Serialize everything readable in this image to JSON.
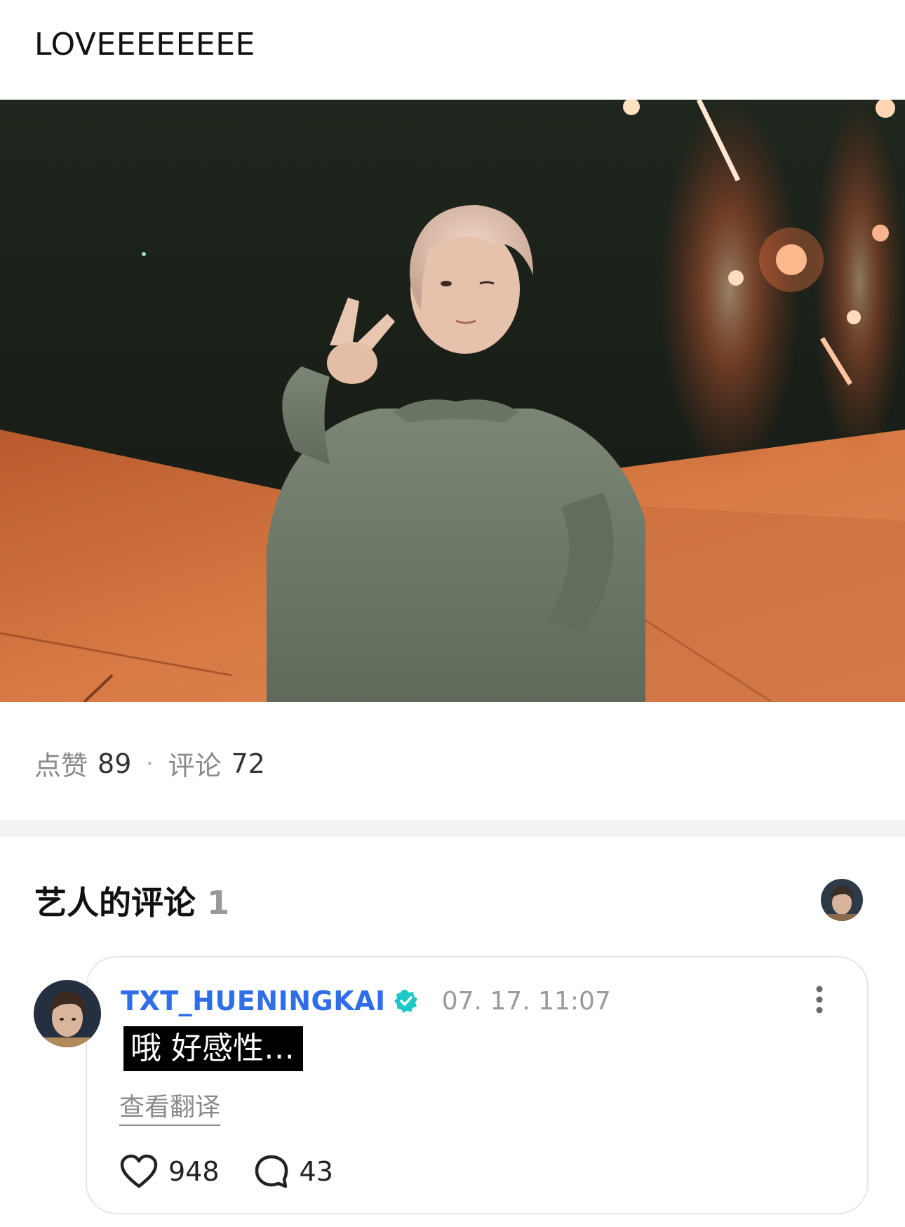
{
  "post": {
    "text": "LOVEEEEEEEE"
  },
  "stats": {
    "likes_label": "点赞",
    "likes_count": "89",
    "separator": "·",
    "comments_label": "评论",
    "comments_count": "72"
  },
  "artist_comments": {
    "title": "艺人的评论",
    "count": "1"
  },
  "comment": {
    "username": "TXT_HUENINGKAI",
    "timestamp": "07. 17. 11:07",
    "text": "哦 好感性…",
    "translate_label": "查看翻译",
    "likes": "948",
    "replies": "43"
  },
  "colors": {
    "username": "#2f6ee6",
    "verified": "#1ec8c8",
    "divider": "#f2f2f2"
  },
  "icons": {
    "verified": "verified-badge-icon",
    "more": "more-vertical-icon",
    "like": "heart-icon",
    "reply": "comment-bubble-icon"
  }
}
